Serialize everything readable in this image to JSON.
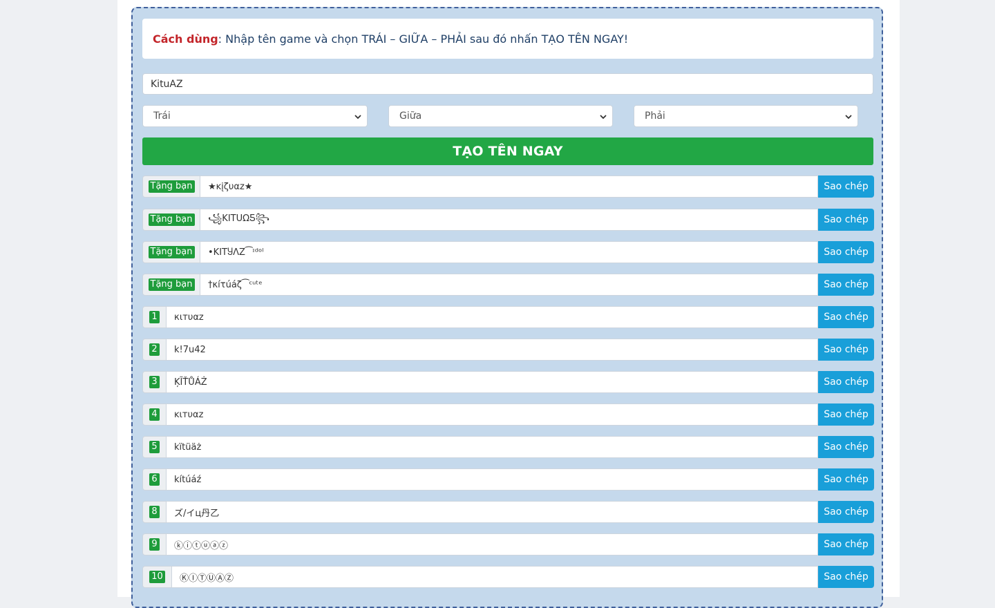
{
  "instructions": {
    "label": "Cách dùng",
    "text": ": Nhập tên game và chọn TRÁI – GIỮA – PHẢI sau đó nhấn TẠO TÊN NGAY!"
  },
  "name_input": {
    "value": "KituAZ"
  },
  "selects": {
    "left": "Trái",
    "middle": "Giữa",
    "right": "Phải"
  },
  "generate_button": "TẠO TÊN NGAY",
  "copy_label": "Sao chép",
  "gift_rows": [
    {
      "badge": "Tặng bạn",
      "value": "★ĸįζυαz★"
    },
    {
      "badge": "Tặng bạn",
      "value": "꧁KITUΩƼ꧂"
    },
    {
      "badge": "Tặng bạn",
      "value": "•KITႸΛZ⁀ᶦᵈᵒˡ"
    },
    {
      "badge": "Tặng bạn",
      "value": "†κíτúáζ⁀ᶜᵘᵗᵉ"
    }
  ],
  "numbered_rows": [
    {
      "badge": "1",
      "value": "кιтυαz"
    },
    {
      "badge": "2",
      "value": "k!7u42"
    },
    {
      "badge": "3",
      "value": "ĶĨŤŮÁŻ"
    },
    {
      "badge": "4",
      "value": "ĸιтυαz"
    },
    {
      "badge": "5",
      "value": "kïtüäż"
    },
    {
      "badge": "6",
      "value": "kítúáź"
    },
    {
      "badge": "8",
      "value": "ズ/イц丹乙"
    },
    {
      "badge": "9",
      "value": "ⓚⓘⓣⓤⓐⓩ"
    },
    {
      "badge": "10",
      "value": "ⓀⒾⓉⓊⒶⓏ"
    }
  ],
  "colors": {
    "panel_bg": "#c5d9ec",
    "generate_green": "#22a745",
    "copy_blue": "#199fd9",
    "label_red": "#c3252a"
  }
}
